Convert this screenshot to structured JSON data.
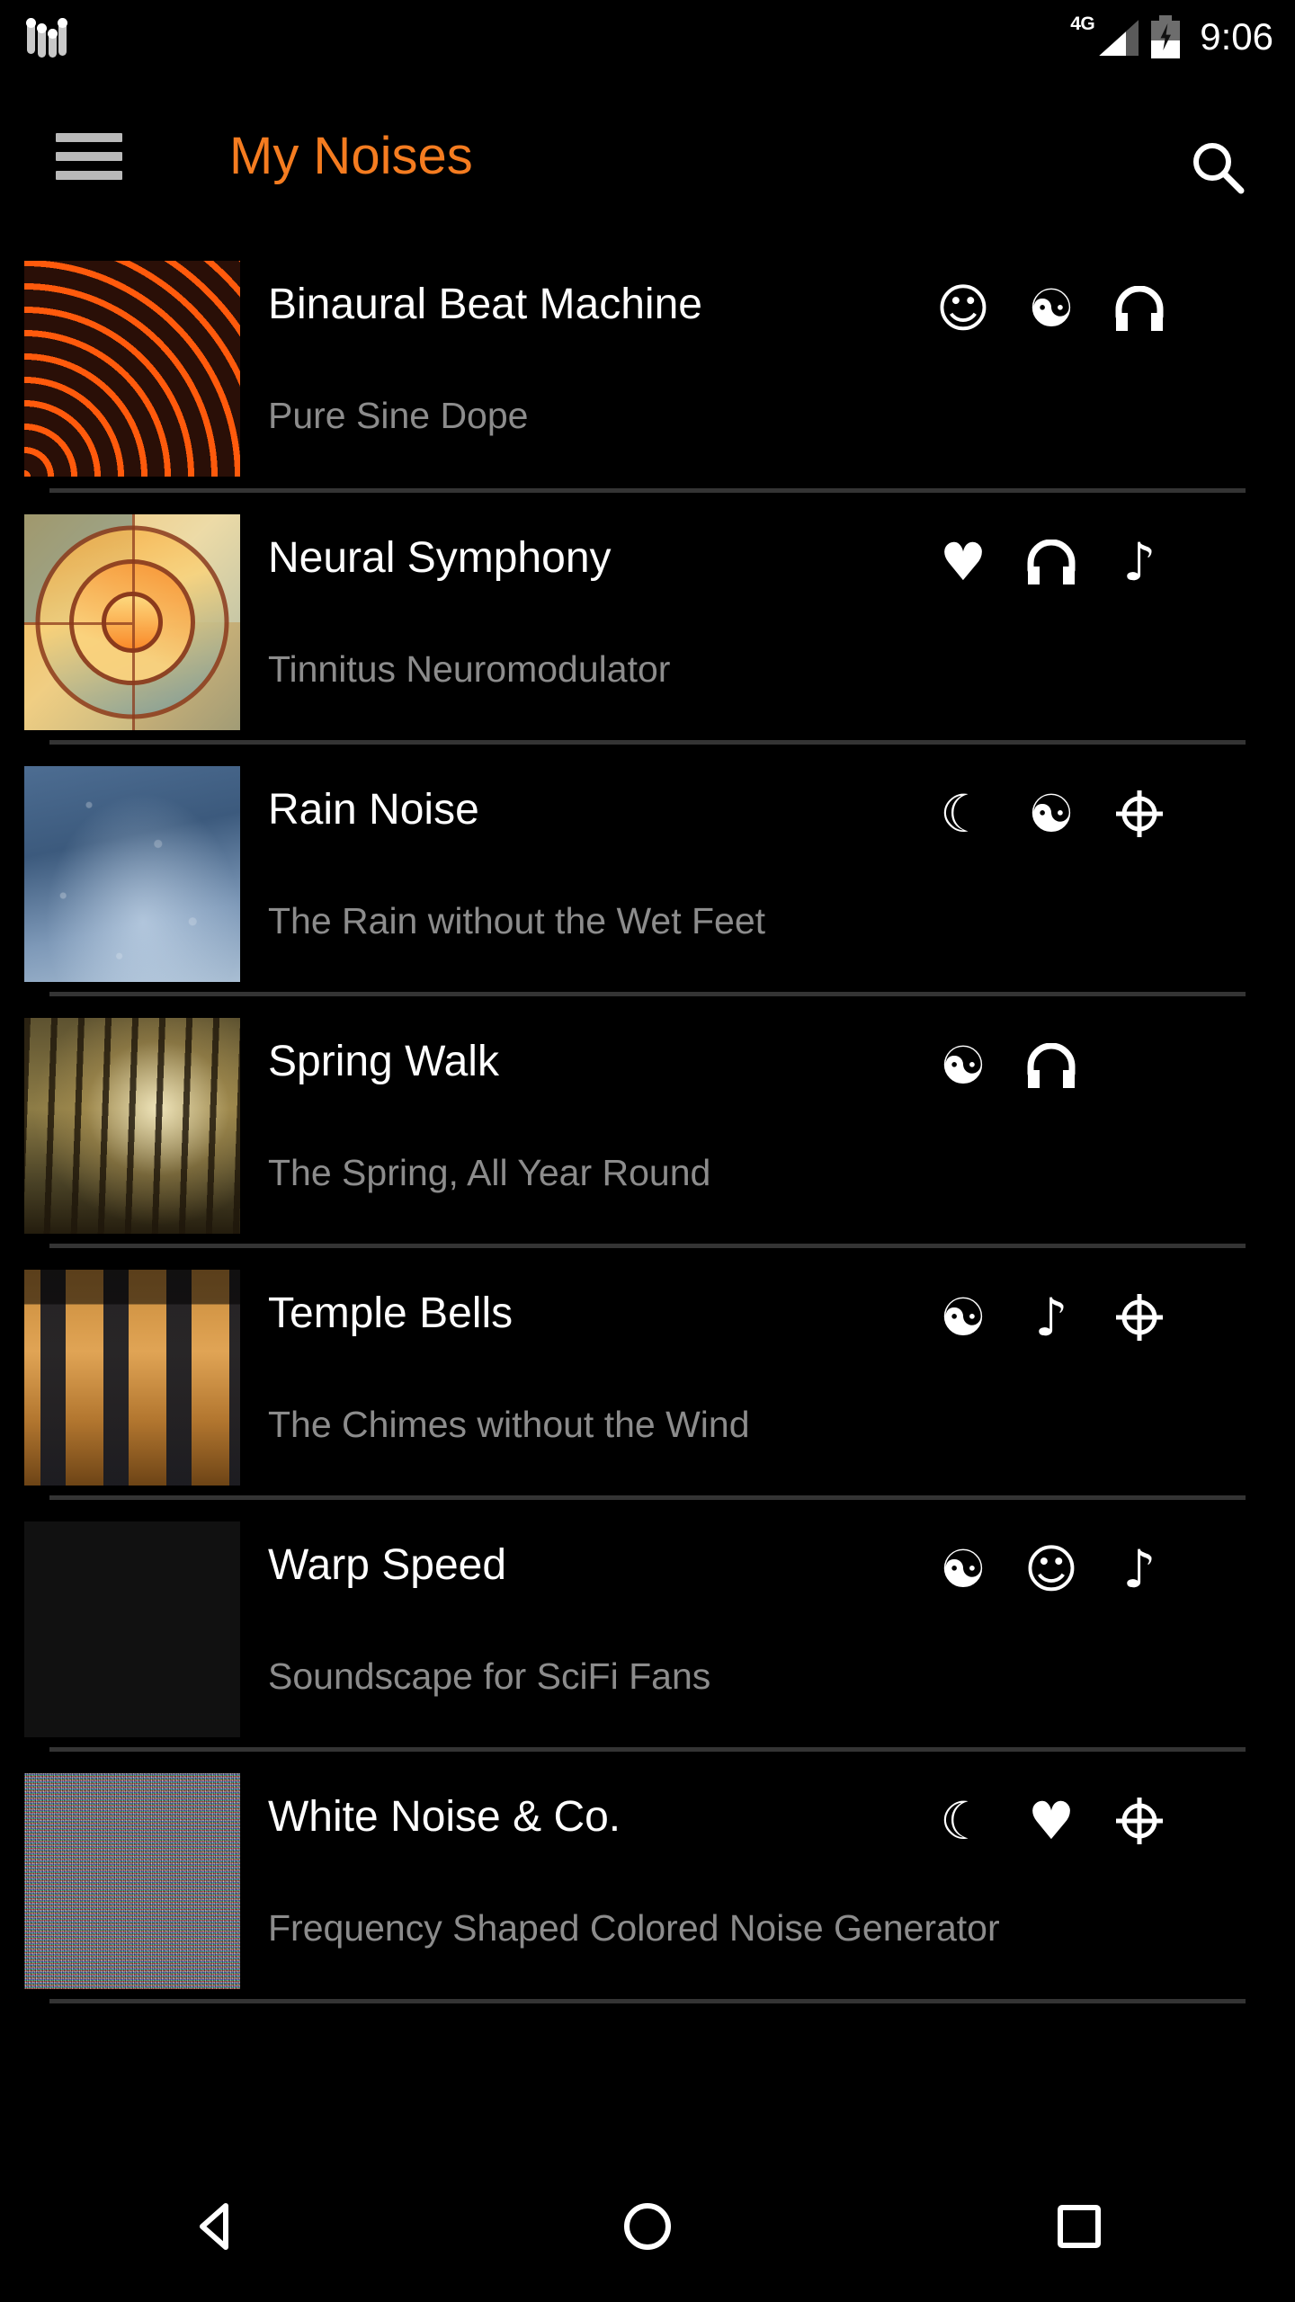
{
  "status_bar": {
    "app_icon": "sliders-icon",
    "network_label": "4G",
    "network_icon": "signal-bars-icon",
    "battery_icon": "battery-charging-icon",
    "time": "9:06"
  },
  "app_bar": {
    "menu_icon": "hamburger-menu-icon",
    "title": "My Noises",
    "title_color": "#F57C20",
    "search_icon": "search-icon"
  },
  "list": {
    "rows": [
      {
        "title": "Binaural Beat Machine",
        "subtitle": "Pure Sine Dope",
        "thumb": "orange-concentric-arcs",
        "icons": [
          "smiley-icon",
          "yin-yang-icon",
          "headphones-icon"
        ],
        "glyphs": [
          "☺",
          "☯",
          "♫"
        ]
      },
      {
        "title": "Neural Symphony",
        "subtitle": "Tinnitus Neuromodulator",
        "thumb": "orange-teal-target-rings",
        "icons": [
          "heart-icon",
          "headphones-icon",
          "music-note-icon"
        ],
        "glyphs": [
          "♥",
          "♫",
          "♪"
        ]
      },
      {
        "title": "Rain Noise",
        "subtitle": "The Rain without the Wet Feet",
        "thumb": "rain-on-window-photo",
        "icons": [
          "crescent-moon-icon",
          "yin-yang-icon",
          "crosshair-icon"
        ],
        "glyphs": [
          "☾",
          "☯",
          "⊕"
        ]
      },
      {
        "title": "Spring Walk",
        "subtitle": "The Spring, All Year Round",
        "thumb": "sunlit-forest-photo",
        "icons": [
          "yin-yang-icon",
          "headphones-icon"
        ],
        "glyphs": [
          "☯",
          "♫"
        ]
      },
      {
        "title": "Temple Bells",
        "subtitle": "The Chimes without the Wind",
        "thumb": "wind-chimes-photo",
        "icons": [
          "yin-yang-icon",
          "music-note-icon",
          "crosshair-icon"
        ],
        "glyphs": [
          "☯",
          "♪",
          "⊕"
        ]
      },
      {
        "title": "Warp Speed",
        "subtitle": "Soundscape for SciFi Fans",
        "thumb": "space-planet-horizon-photo",
        "icons": [
          "yin-yang-icon",
          "smiley-icon",
          "music-note-icon"
        ],
        "glyphs": [
          "☯",
          "☺",
          "♪"
        ]
      },
      {
        "title": "White Noise & Co.",
        "subtitle": "Frequency Shaped Colored Noise Generator",
        "thumb": "rgb-static-noise",
        "icons": [
          "crescent-moon-icon",
          "heart-icon",
          "crosshair-icon"
        ],
        "glyphs": [
          "☾",
          "♥",
          "⊕"
        ]
      }
    ]
  },
  "nav_bar": {
    "back": "back-triangle-icon",
    "home": "home-circle-icon",
    "recents": "recents-square-icon"
  },
  "theme": {
    "background": "#000000",
    "accent": "#F57C20",
    "title_text": "#FFFFFF",
    "subtitle_text": "#8C8C8C",
    "divider": "#343434"
  }
}
